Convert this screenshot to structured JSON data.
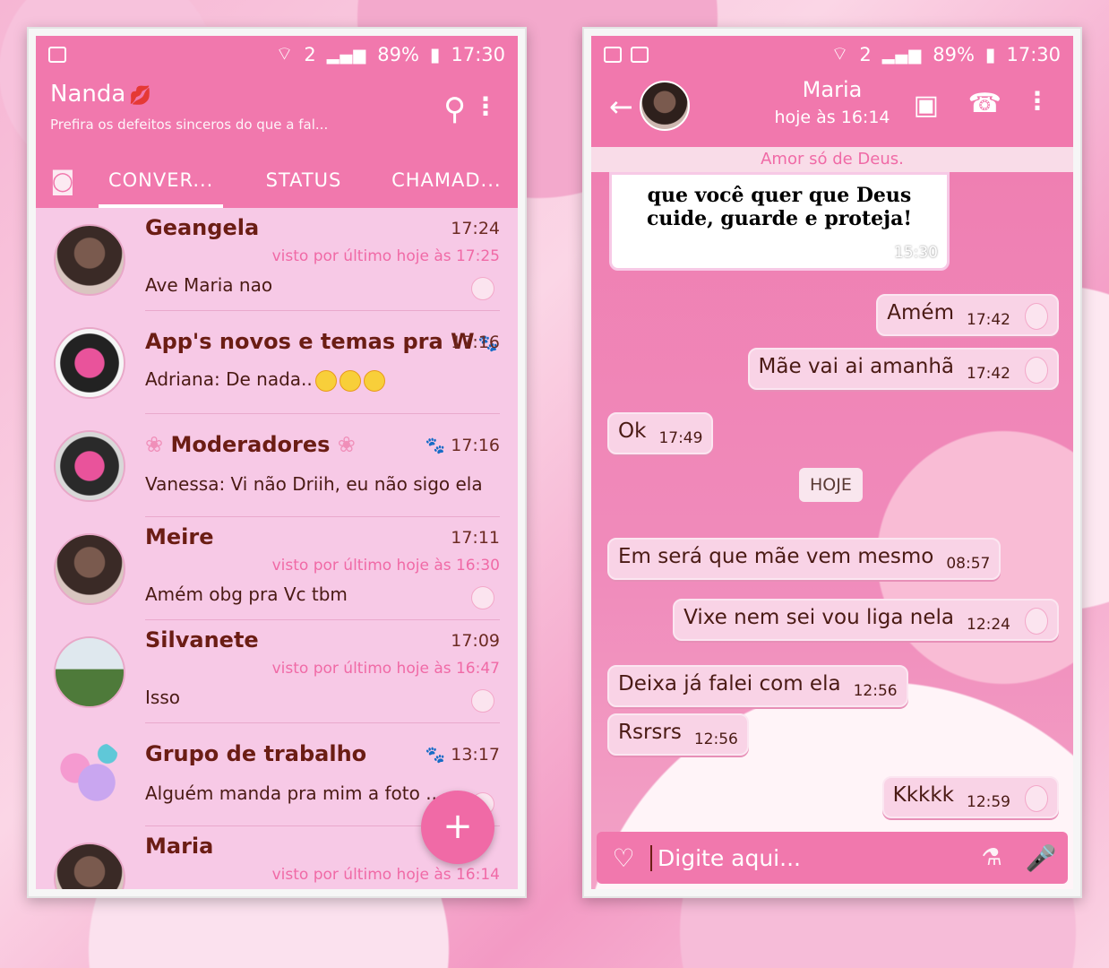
{
  "left": {
    "status": {
      "sim": "2",
      "battery": "89%",
      "time": "17:30"
    },
    "header": {
      "title": "Nanda",
      "subtitle": "Prefira os defeitos sinceros do que a fal..."
    },
    "tabs": [
      "CONVER...",
      "STATUS",
      "CHAMAD..."
    ],
    "chats": [
      {
        "name": "Geangela",
        "time": "17:24",
        "seen": "visto por último hoje às 17:25",
        "message": "Ave Maria nao"
      },
      {
        "name": "App's novos e temas pra W",
        "time": "17:16",
        "seen": "",
        "message": "Adriana: De nada.."
      },
      {
        "name": "Moderadores",
        "time": "17:16",
        "seen": "",
        "message": "Vanessa: Vi não Driih, eu não sigo ela"
      },
      {
        "name": "Meire",
        "time": "17:11",
        "seen": "visto por último hoje às 16:30",
        "message": "Amém obg pra Vc tbm"
      },
      {
        "name": "Silvanete",
        "time": "17:09",
        "seen": "visto por último hoje às 16:47",
        "message": "Isso"
      },
      {
        "name": "Grupo de trabalho",
        "time": "13:17",
        "seen": "",
        "message": "Alguém manda pra mim a foto ..."
      },
      {
        "name": "Maria",
        "time": "",
        "seen": "visto por último hoje às 16:14",
        "message": ""
      }
    ],
    "fab": "+"
  },
  "right": {
    "status": {
      "sim": "2",
      "battery": "89%",
      "time": "17:30"
    },
    "header": {
      "name": "Maria",
      "last_seen": "hoje às 16:14"
    },
    "contact_status": "Amor só de Deus.",
    "image_caption": {
      "line1": "que você quer que Deus",
      "line2": "cuide, guarde e proteja!",
      "time": "15:30"
    },
    "messages": [
      {
        "text": "Amém",
        "time": "17:42",
        "dir": "out"
      },
      {
        "text": "Mãe vai ai amanhã",
        "time": "17:42",
        "dir": "out"
      },
      {
        "text": "Ok",
        "time": "17:49",
        "dir": "in"
      },
      {
        "text": "Em será que mãe vem mesmo",
        "time": "08:57",
        "dir": "in"
      },
      {
        "text": "Vixe nem sei vou liga nela",
        "time": "12:24",
        "dir": "out"
      },
      {
        "text": "Deixa já falei com ela",
        "time": "12:56",
        "dir": "in"
      },
      {
        "text": "Rsrsrs",
        "time": "12:56",
        "dir": "in"
      },
      {
        "text": "Kkkkk",
        "time": "12:59",
        "dir": "out"
      }
    ],
    "day_label": "HOJE",
    "composer": {
      "placeholder": "Digite aqui..."
    }
  }
}
